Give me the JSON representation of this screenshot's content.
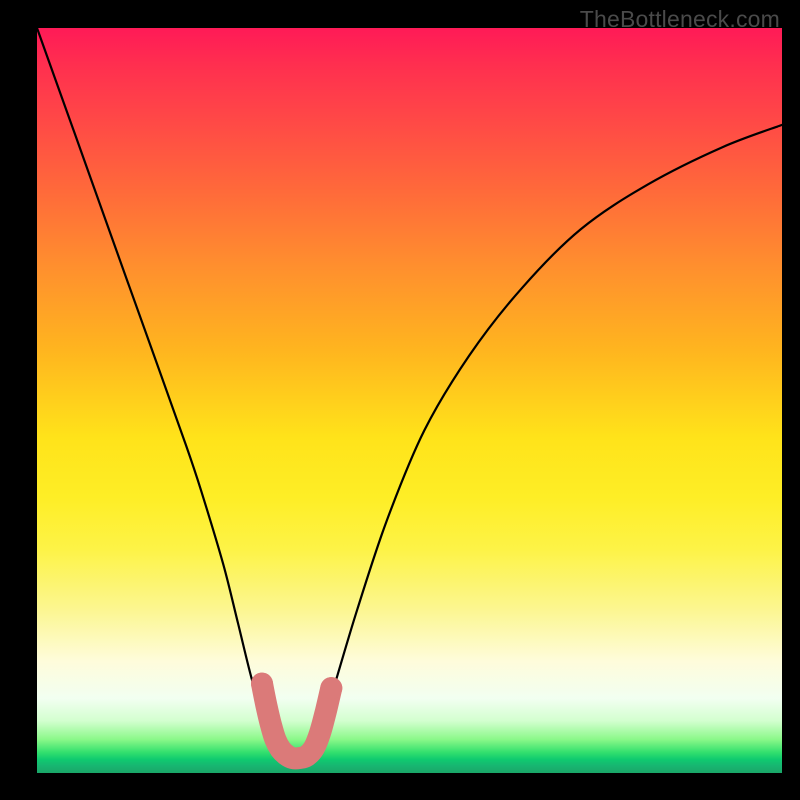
{
  "watermark": "TheBottleneck.com",
  "chart_data": {
    "type": "line",
    "title": "",
    "xlabel": "",
    "ylabel": "",
    "xlim": [
      0,
      100
    ],
    "ylim": [
      0,
      100
    ],
    "grid": false,
    "series": [
      {
        "name": "bottleneck-curve",
        "color": "#000000",
        "x": [
          0,
          5,
          10,
          15,
          20,
          22,
          25,
          27,
          29,
          31,
          33,
          34.5,
          36,
          37,
          38.5,
          40,
          43,
          47,
          52,
          58,
          65,
          73,
          82,
          92,
          100
        ],
        "y": [
          100,
          86,
          72,
          58,
          44,
          38,
          28,
          20,
          12,
          6,
          3,
          2,
          2,
          3,
          7,
          12,
          22,
          34,
          46,
          56,
          65,
          73,
          79,
          84,
          87
        ]
      }
    ],
    "marker": {
      "name": "optimal-range",
      "color": "#db7a79",
      "x": [
        30.2,
        30.8,
        31.4,
        32.0,
        32.7,
        33.5,
        34.3,
        35.2,
        36.2,
        37.2,
        38.0,
        38.8,
        39.5
      ],
      "y": [
        12.0,
        9.0,
        6.5,
        4.5,
        3.2,
        2.4,
        2.0,
        2.0,
        2.3,
        3.4,
        5.4,
        8.4,
        11.4
      ]
    },
    "background_gradient": {
      "top": "#ff1a57",
      "mid": "#ffe31a",
      "bottom": "#1aa668"
    }
  }
}
